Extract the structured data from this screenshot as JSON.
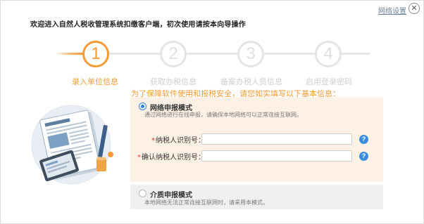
{
  "header": {
    "network_settings": "网络设置",
    "close_glyph": "✕",
    "welcome": "欢迎进入自然人税收管理系统扣缴客户端，初次使用请按本向导操作"
  },
  "steps": [
    {
      "number": "1",
      "label": "录入单位信息",
      "active": true
    },
    {
      "number": "2",
      "label": "获取办税信息",
      "active": false
    },
    {
      "number": "3",
      "label": "备案办税人员信息",
      "active": false
    },
    {
      "number": "4",
      "label": "启用登录密码",
      "active": false
    }
  ],
  "notice": "为了保障软件使用和报税安全，请您如实填写以下基本信息：",
  "online_mode": {
    "title": "网络申报模式",
    "desc": "通过网络进行在线申报，请确保本地网络可以正常连接互联网。",
    "selected": true,
    "fields": [
      {
        "label": "纳税人识别号：",
        "value": "",
        "help": "?"
      },
      {
        "label": "确认纳税人识别号：",
        "value": "",
        "help": "?"
      }
    ]
  },
  "media_mode": {
    "title": "介质申报模式",
    "desc": "本地网络无法正常连接互联网时，请采用本模式。",
    "selected": false
  },
  "colors": {
    "accent": "#f59a35",
    "link": "#6a7f99",
    "radio": "#2f7fd4",
    "help": "#3d8ee0",
    "online_panel_bg": "#fdf0e4",
    "media_panel_bg": "#efefef"
  },
  "illustration": {
    "icon": "document-with-tablet-icon"
  }
}
